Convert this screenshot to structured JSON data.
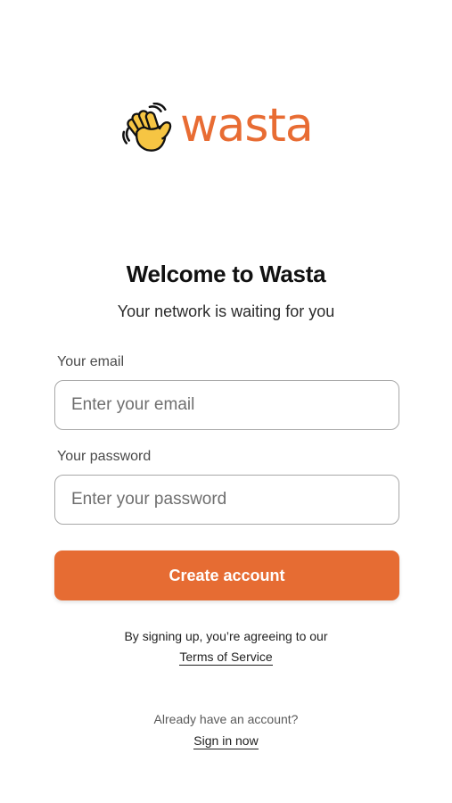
{
  "brand": {
    "name": "wasta",
    "color": "#e86c33",
    "icon": "waving-hand-icon"
  },
  "header": {
    "title": "Welcome to Wasta",
    "subtitle": "Your network is waiting for you"
  },
  "form": {
    "email_label": "Your email",
    "email_placeholder": "Enter your email",
    "email_value": "",
    "password_label": "Your password",
    "password_placeholder": "Enter your password",
    "password_value": "",
    "submit_label": "Create account",
    "submit_color": "#e66c33"
  },
  "legal": {
    "text": "By signing up, you’re agreeing to our",
    "link": "Terms of Service"
  },
  "signin": {
    "prompt": "Already have an account?",
    "link": "Sign in now"
  }
}
